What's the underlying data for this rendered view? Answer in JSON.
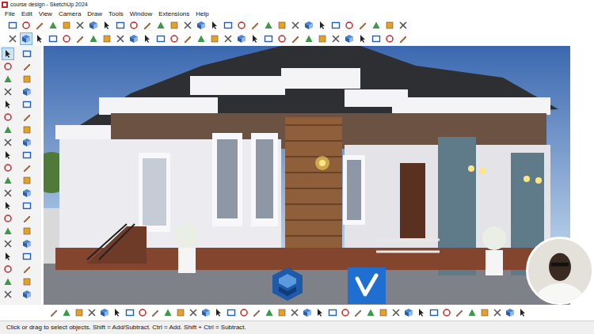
{
  "window": {
    "title": "course design - SketchUp 2024"
  },
  "menu": [
    "File",
    "Edit",
    "View",
    "Camera",
    "Draw",
    "Tools",
    "Window",
    "Extensions",
    "Help"
  ],
  "toolbar_row_1": [
    {
      "selected": false
    },
    {
      "selected": false
    },
    {
      "selected": false
    },
    {
      "selected": false
    },
    {
      "selected": false
    },
    {
      "selected": false
    },
    {
      "selected": false
    },
    {
      "selected": false
    },
    {
      "selected": false
    },
    {
      "selected": false
    },
    {
      "selected": false
    },
    {
      "selected": false
    },
    {
      "selected": false
    },
    {
      "selected": false
    },
    {
      "selected": false
    },
    {
      "selected": false
    },
    {
      "selected": false
    },
    {
      "selected": false
    },
    {
      "selected": false
    },
    {
      "selected": false
    },
    {
      "selected": false
    },
    {
      "selected": false
    },
    {
      "selected": false
    },
    {
      "selected": false
    },
    {
      "selected": false
    },
    {
      "selected": false
    },
    {
      "selected": false
    },
    {
      "selected": false
    },
    {
      "selected": false
    },
    {
      "selected": false
    }
  ],
  "toolbar_row_2": [
    {
      "selected": false
    },
    {
      "selected": true
    },
    {
      "selected": false
    },
    {
      "selected": false
    },
    {
      "selected": false
    },
    {
      "selected": false
    },
    {
      "selected": false
    },
    {
      "selected": false
    },
    {
      "selected": false
    },
    {
      "selected": false
    },
    {
      "selected": false
    },
    {
      "selected": false
    },
    {
      "selected": false
    },
    {
      "selected": false
    },
    {
      "selected": false
    },
    {
      "selected": false
    },
    {
      "selected": false
    },
    {
      "selected": false
    },
    {
      "selected": false
    },
    {
      "selected": false
    },
    {
      "selected": false
    },
    {
      "selected": false
    },
    {
      "selected": false
    },
    {
      "selected": false
    },
    {
      "selected": false
    },
    {
      "selected": false
    },
    {
      "selected": false
    },
    {
      "selected": false
    },
    {
      "selected": false
    },
    {
      "selected": false
    }
  ],
  "left_toolbar": [
    {
      "selected": true
    },
    {
      "selected": false
    },
    {
      "selected": false
    },
    {
      "selected": false
    },
    {
      "selected": false
    },
    {
      "selected": false
    },
    {
      "selected": false
    },
    {
      "selected": false
    },
    {
      "selected": false
    },
    {
      "selected": false
    },
    {
      "selected": false
    },
    {
      "selected": false
    },
    {
      "selected": false
    },
    {
      "selected": false
    },
    {
      "selected": false
    },
    {
      "selected": false
    },
    {
      "selected": false
    },
    {
      "selected": false
    },
    {
      "selected": false
    },
    {
      "selected": false
    },
    {
      "selected": false
    },
    {
      "selected": false
    },
    {
      "selected": false
    },
    {
      "selected": false
    },
    {
      "selected": false
    },
    {
      "selected": false
    },
    {
      "selected": false
    },
    {
      "selected": false
    },
    {
      "selected": false
    },
    {
      "selected": false
    },
    {
      "selected": false
    },
    {
      "selected": false
    },
    {
      "selected": false
    },
    {
      "selected": false
    },
    {
      "selected": false
    },
    {
      "selected": false
    },
    {
      "selected": false
    },
    {
      "selected": false
    },
    {
      "selected": false
    },
    {
      "selected": false
    }
  ],
  "bottom_toolbar": [
    {
      "selected": false
    },
    {
      "selected": false
    },
    {
      "selected": false
    },
    {
      "selected": false
    },
    {
      "selected": false
    },
    {
      "selected": false
    },
    {
      "selected": false
    },
    {
      "selected": false
    },
    {
      "selected": false
    },
    {
      "selected": false
    },
    {
      "selected": false
    },
    {
      "selected": false
    },
    {
      "selected": false
    },
    {
      "selected": false
    },
    {
      "selected": false
    },
    {
      "selected": false
    },
    {
      "selected": false
    },
    {
      "selected": false
    },
    {
      "selected": false
    },
    {
      "selected": false
    },
    {
      "selected": false
    },
    {
      "selected": false
    },
    {
      "selected": false
    },
    {
      "selected": false
    },
    {
      "selected": false
    },
    {
      "selected": false
    },
    {
      "selected": false
    },
    {
      "selected": false
    },
    {
      "selected": false
    },
    {
      "selected": false
    },
    {
      "selected": false
    },
    {
      "selected": false
    },
    {
      "selected": false
    },
    {
      "selected": false
    },
    {
      "selected": false
    },
    {
      "selected": false
    },
    {
      "selected": false
    },
    {
      "selected": false
    }
  ],
  "status_bar": {
    "text": "Click or drag to select objects. Shift = Add/Subtract. Ctrl = Add. Shift + Ctrl = Subtract."
  }
}
